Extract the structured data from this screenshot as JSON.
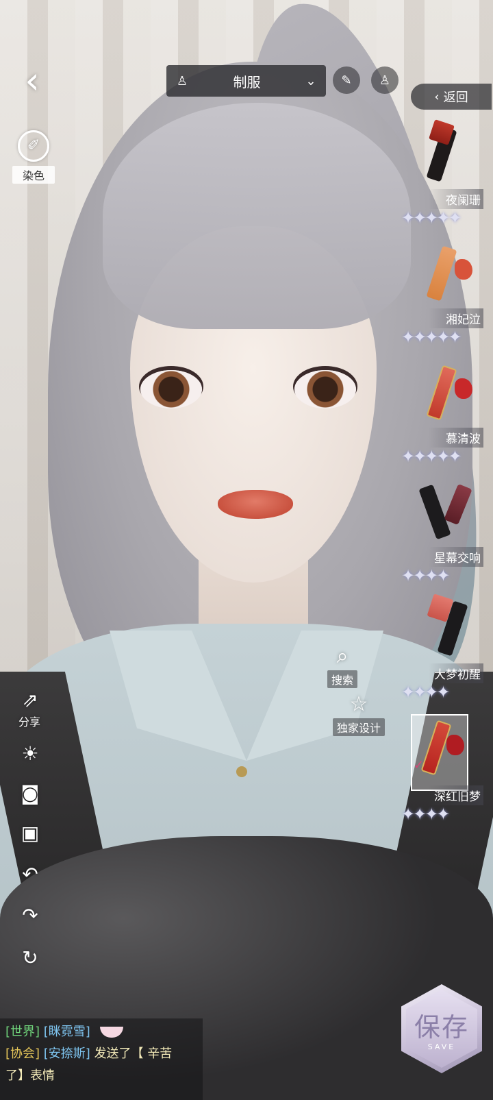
{
  "category": {
    "label": "制服"
  },
  "top": {
    "return_label": "返回"
  },
  "tools": {
    "dye_label": "染色",
    "share_label": "分享"
  },
  "center": {
    "search_label": "搜索",
    "exclusive_label": "独家设计"
  },
  "lipsticks": [
    {
      "name": "夜阑珊",
      "stars": "✦✦✦✦✦",
      "tube": "#1e1a1a",
      "swatch": ""
    },
    {
      "name": "湘妃泣",
      "stars": "✦✦✦✦✦",
      "tube": "#d9823e",
      "swatch": "#d8533a"
    },
    {
      "name": "慕清波",
      "stars": "✦✦✦✦✦",
      "tube": "#c13a2b",
      "swatch": "#c8282a"
    },
    {
      "name": "星幕交响",
      "stars": "✦✦✦✦",
      "tube": "#1c1b1d",
      "swatch": "#6e2a33"
    },
    {
      "name": "大梦初醒",
      "stars": "✦✦✦✦",
      "tube": "#1b1a1c",
      "swatch": ""
    },
    {
      "name": "深红旧梦",
      "stars": "✦✦✦✦",
      "tube": "#b7231f",
      "swatch": "#b01c22"
    }
  ],
  "chat": {
    "line1_tag": "[世界]",
    "line1_user": "[眯霓雪]",
    "line2_tag": "[协会]",
    "line2_user": "[安捺斯]",
    "line2_msg_a": "发送了【 辛苦",
    "line2_msg_b": "了】表情"
  },
  "save": {
    "label": "保存",
    "sub": "SAVE"
  },
  "colors": {
    "accent": "#8b7fa8",
    "world_tag": "#6fd27a",
    "guild_tag": "#e7c75a",
    "username": "#7ec4ef"
  }
}
